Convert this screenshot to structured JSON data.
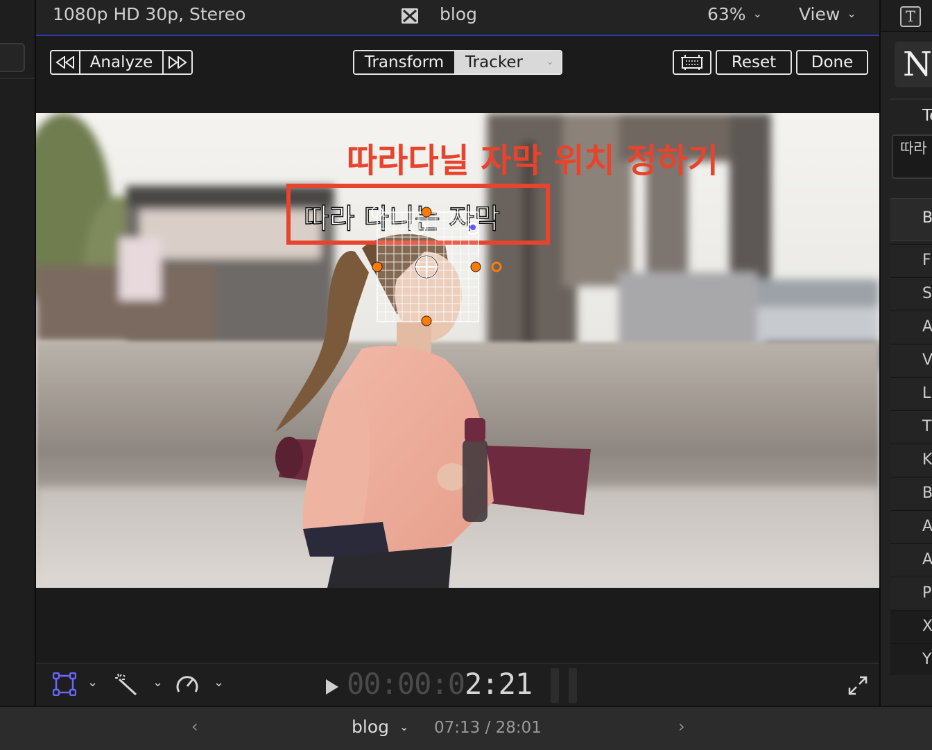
{
  "viewer": {
    "format_label": "1080p HD 30p, Stereo",
    "project_name": "blog",
    "zoom": "63%",
    "view_menu": "View"
  },
  "tracker_bar": {
    "analyze_label": "Analyze",
    "mode_transform": "Transform",
    "mode_tracker": "Tracker",
    "reset_label": "Reset",
    "done_label": "Done"
  },
  "canvas": {
    "annotation_title": "따라다닐 자막 위치 정하기",
    "tracked_caption": "따라 다니는 자막",
    "annotation_color": "#e8432c",
    "handle_color": "#ff7a00"
  },
  "playback": {
    "timecode_dim": "00:00:0",
    "timecode_bright": "2:21"
  },
  "timeline": {
    "name": "blog",
    "duration": "07:13 / 28:01"
  },
  "inspector": {
    "title_preview": "No",
    "heading": "Te",
    "text_value": "따라",
    "basic_row": "B",
    "rows": [
      "F",
      "S",
      "A",
      "V",
      "Li",
      "T",
      "K",
      "B",
      "A",
      "A",
      "P",
      "X",
      "Y"
    ]
  },
  "icons": [
    "clapper-icon",
    "rewind-icon",
    "forward-icon",
    "overlay-icon",
    "transform-tool-icon",
    "magic-wand-icon",
    "speed-icon",
    "fullscreen-icon",
    "text-inspector-icon"
  ]
}
